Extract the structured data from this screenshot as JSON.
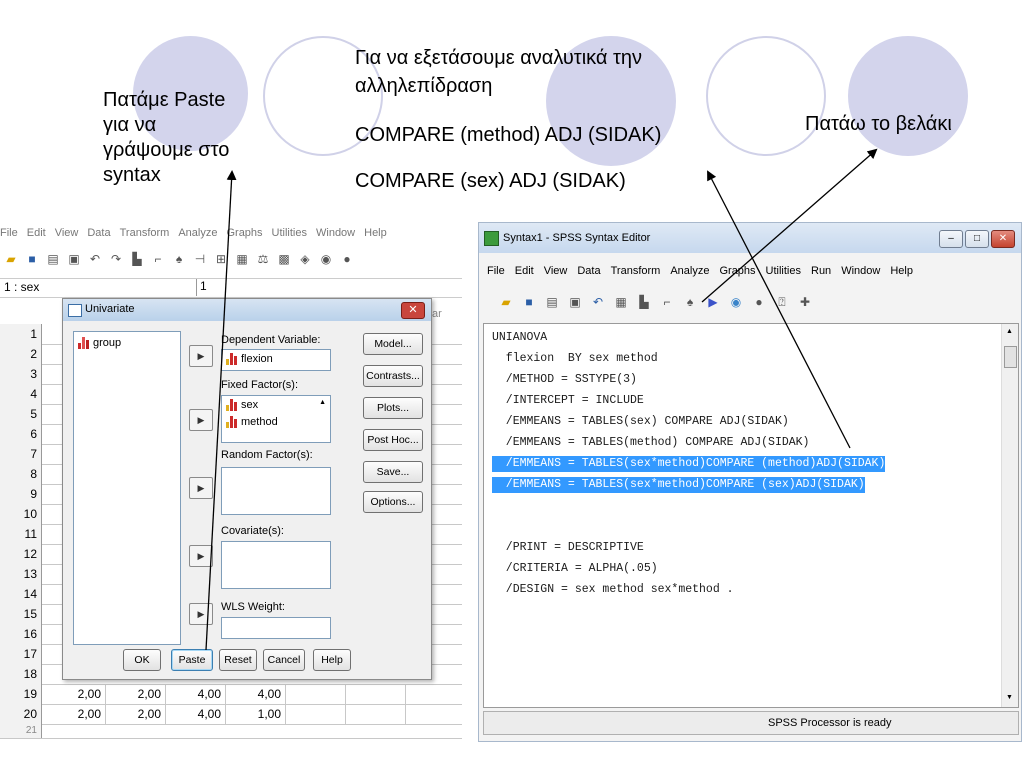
{
  "slide": {
    "note_paste": "Πατάμε Paste\nγια να\nγράψουμε στο\nsyntax",
    "note_interaction": "Για να εξετάσουμε αναλυτικά την αλληλεπίδραση",
    "compare_method": "COMPARE (method) ADJ (SIDAK)",
    "compare_sex": "COMPARE (sex) ADJ (SIDAK)",
    "note_arrow": "Πατάω το βελάκι"
  },
  "data_editor": {
    "menu": [
      "File",
      "Edit",
      "View",
      "Data",
      "Transform",
      "Analyze",
      "Graphs",
      "Utilities",
      "Window",
      "Help"
    ],
    "cell_ref": "1 : sex",
    "cell_value": "1",
    "var_header_partial": "ar",
    "row_numbers": [
      "1",
      "2",
      "3",
      "4",
      "5",
      "6",
      "7",
      "8",
      "9",
      "10",
      "11",
      "12",
      "13",
      "14",
      "15",
      "16",
      "17",
      "18",
      "19",
      "20",
      "21"
    ],
    "visible_rows": [
      {
        "n": "19",
        "c1": "2,00",
        "c2": "2,00",
        "c3": "4,00",
        "c4": "4,00"
      },
      {
        "n": "20",
        "c1": "2,00",
        "c2": "2,00",
        "c3": "4,00",
        "c4": "1,00"
      }
    ]
  },
  "dialog": {
    "title": "Univariate",
    "close": "✕",
    "source_vars": [
      "group"
    ],
    "dependent_label": "Dependent Variable:",
    "dependent_value": "flexion",
    "fixed_label": "Fixed Factor(s):",
    "fixed_values": [
      "sex",
      "method"
    ],
    "random_label": "Random Factor(s):",
    "covariate_label": "Covariate(s):",
    "wls_label": "WLS Weight:",
    "side_buttons": [
      "Model...",
      "Contrasts...",
      "Plots...",
      "Post Hoc...",
      "Save...",
      "Options..."
    ],
    "bottom_buttons": [
      "OK",
      "Paste",
      "Reset",
      "Cancel",
      "Help"
    ]
  },
  "syntax_editor": {
    "title": "Syntax1 - SPSS Syntax Editor",
    "menu": [
      "File",
      "Edit",
      "View",
      "Data",
      "Transform",
      "Analyze",
      "Graphs",
      "Utilities",
      "Run",
      "Window",
      "Help"
    ],
    "code": [
      "UNIANOVA",
      "  flexion  BY sex method",
      "  /METHOD = SSTYPE(3)",
      "  /INTERCEPT = INCLUDE",
      "  /EMMEANS = TABLES(sex) COMPARE ADJ(SIDAK)",
      "  /EMMEANS = TABLES(method) COMPARE ADJ(SIDAK)",
      "  /EMMEANS = TABLES(sex*method)COMPARE (method)ADJ(SIDAK)",
      "  /EMMEANS = TABLES(sex*method)COMPARE (sex)ADJ(SIDAK)",
      "",
      "",
      "",
      "  /PRINT = DESCRIPTIVE",
      "  /CRITERIA = ALPHA(.05)",
      "  /DESIGN = sex method sex*method ."
    ],
    "status": "SPSS Processor is ready"
  }
}
